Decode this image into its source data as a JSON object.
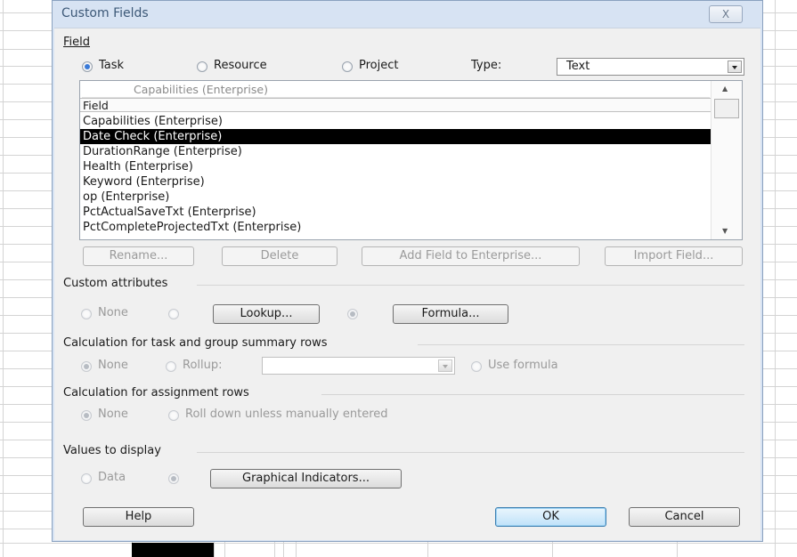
{
  "dialog": {
    "title": "Custom Fields",
    "close_glyph": "X"
  },
  "field_section": {
    "label": "Field",
    "radios": [
      {
        "label": "Task",
        "selected": true
      },
      {
        "label": "Resource",
        "selected": false
      },
      {
        "label": "Project",
        "selected": false
      }
    ],
    "type_label": "Type:",
    "type_value": "Text"
  },
  "field_list": {
    "search_text": "Capabilities (Enterprise)",
    "header": "Field",
    "rows": [
      "Capabilities (Enterprise)",
      "Date Check (Enterprise)",
      "DurationRange (Enterprise)",
      "Health (Enterprise)",
      "Keyword (Enterprise)",
      "op (Enterprise)",
      "PctActualSaveTxt (Enterprise)",
      "PctCompleteProjectedTxt (Enterprise)"
    ],
    "selected_index": 1
  },
  "field_buttons": {
    "rename": "Rename...",
    "delete": "Delete",
    "add_to_enterprise": "Add Field to Enterprise...",
    "import": "Import Field..."
  },
  "custom_attributes": {
    "label": "Custom attributes",
    "none": "None",
    "lookup": "Lookup...",
    "formula": "Formula..."
  },
  "calc_summary": {
    "label": "Calculation for task and group summary rows",
    "none": "None",
    "rollup": "Rollup:",
    "rollup_value": "",
    "use_formula": "Use formula"
  },
  "calc_assignment": {
    "label": "Calculation for assignment rows",
    "none": "None",
    "roll_down": "Roll down unless manually entered"
  },
  "values_display": {
    "label": "Values to display",
    "data": "Data",
    "graphical": "Graphical Indicators..."
  },
  "footer": {
    "help": "Help",
    "ok": "OK",
    "cancel": "Cancel"
  }
}
